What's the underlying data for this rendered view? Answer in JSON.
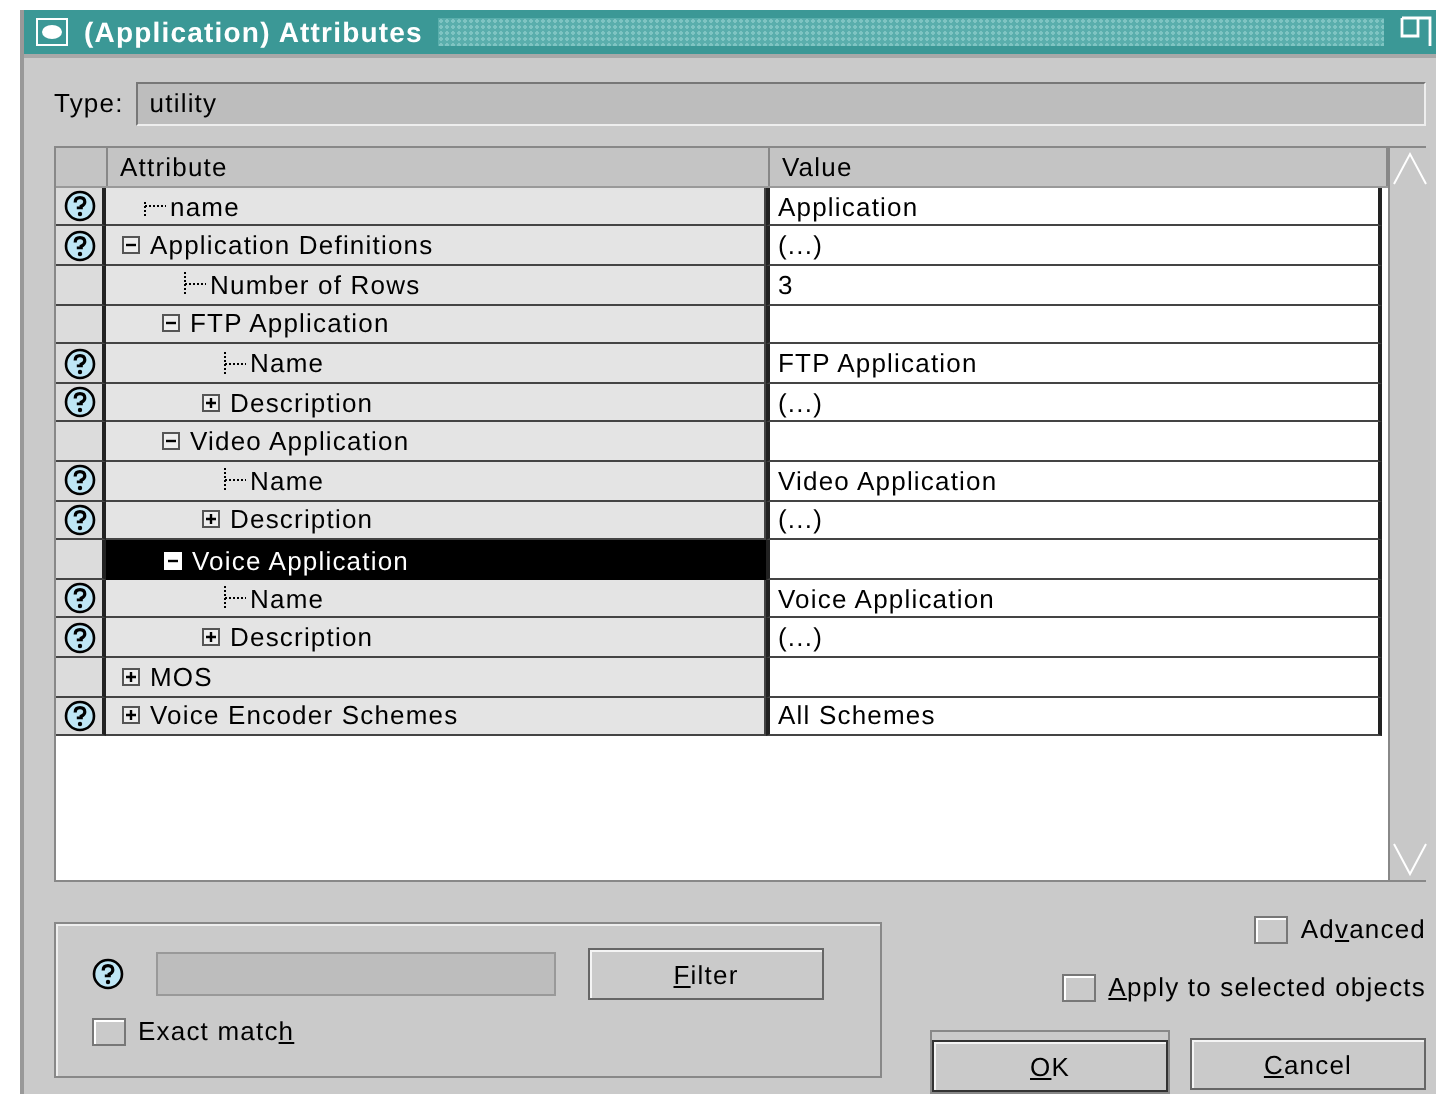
{
  "window": {
    "title": "(Application) Attributes"
  },
  "type_field": {
    "label": "Type:",
    "value": "utility"
  },
  "table": {
    "columns": [
      "Attribute",
      "Value"
    ],
    "rows": [
      {
        "label": "name",
        "value": "Application",
        "help": true,
        "selected": false
      },
      {
        "label": "Application Definitions",
        "value": "(...)",
        "help": true,
        "selected": false,
        "expanded": true,
        "children": [
          {
            "label": "Number of Rows",
            "value": "3",
            "help": false,
            "selected": false
          },
          {
            "label": "FTP Application",
            "help": false,
            "selected": false,
            "expanded": true,
            "children": [
              {
                "label": "Name",
                "value": "FTP Application",
                "help": true,
                "selected": false
              },
              {
                "label": "Description",
                "value": "(...)",
                "help": true,
                "selected": false,
                "expanded": false
              }
            ]
          },
          {
            "label": "Video Application",
            "help": false,
            "selected": false,
            "expanded": true,
            "children": [
              {
                "label": "Name",
                "value": "Video Application",
                "help": true,
                "selected": false
              },
              {
                "label": "Description",
                "value": "(...)",
                "help": true,
                "selected": false,
                "expanded": false
              }
            ]
          },
          {
            "label": "Voice Application",
            "help": false,
            "selected": true,
            "expanded": true,
            "children": [
              {
                "label": "Name",
                "value": "Voice Application",
                "help": true,
                "selected": false
              },
              {
                "label": "Description",
                "value": "(...)",
                "help": true,
                "selected": false,
                "expanded": false
              }
            ]
          }
        ]
      },
      {
        "label": "MOS",
        "help": false,
        "selected": false,
        "expanded": false
      },
      {
        "label": "Voice Encoder Schemes",
        "value": "All Schemes",
        "help": true,
        "selected": false,
        "expanded": false
      }
    ]
  },
  "filter": {
    "help": true,
    "button": {
      "label": {
        "key": "F",
        "after": "ilter"
      }
    },
    "exact_match": {
      "label": {
        "before": "Exact matc",
        "key": "h"
      },
      "checked": false
    }
  },
  "advanced": {
    "label": {
      "before": "Ad",
      "key": "v",
      "after": "anced"
    },
    "checked": false
  },
  "apply_selected": {
    "label": {
      "key": "A",
      "after": "pply to selected objects"
    },
    "checked": false
  },
  "buttons": [
    {
      "label": {
        "key": "O",
        "after": "K"
      },
      "default": true
    },
    {
      "label": {
        "key": "C",
        "after": "ancel"
      },
      "default": false
    }
  ]
}
